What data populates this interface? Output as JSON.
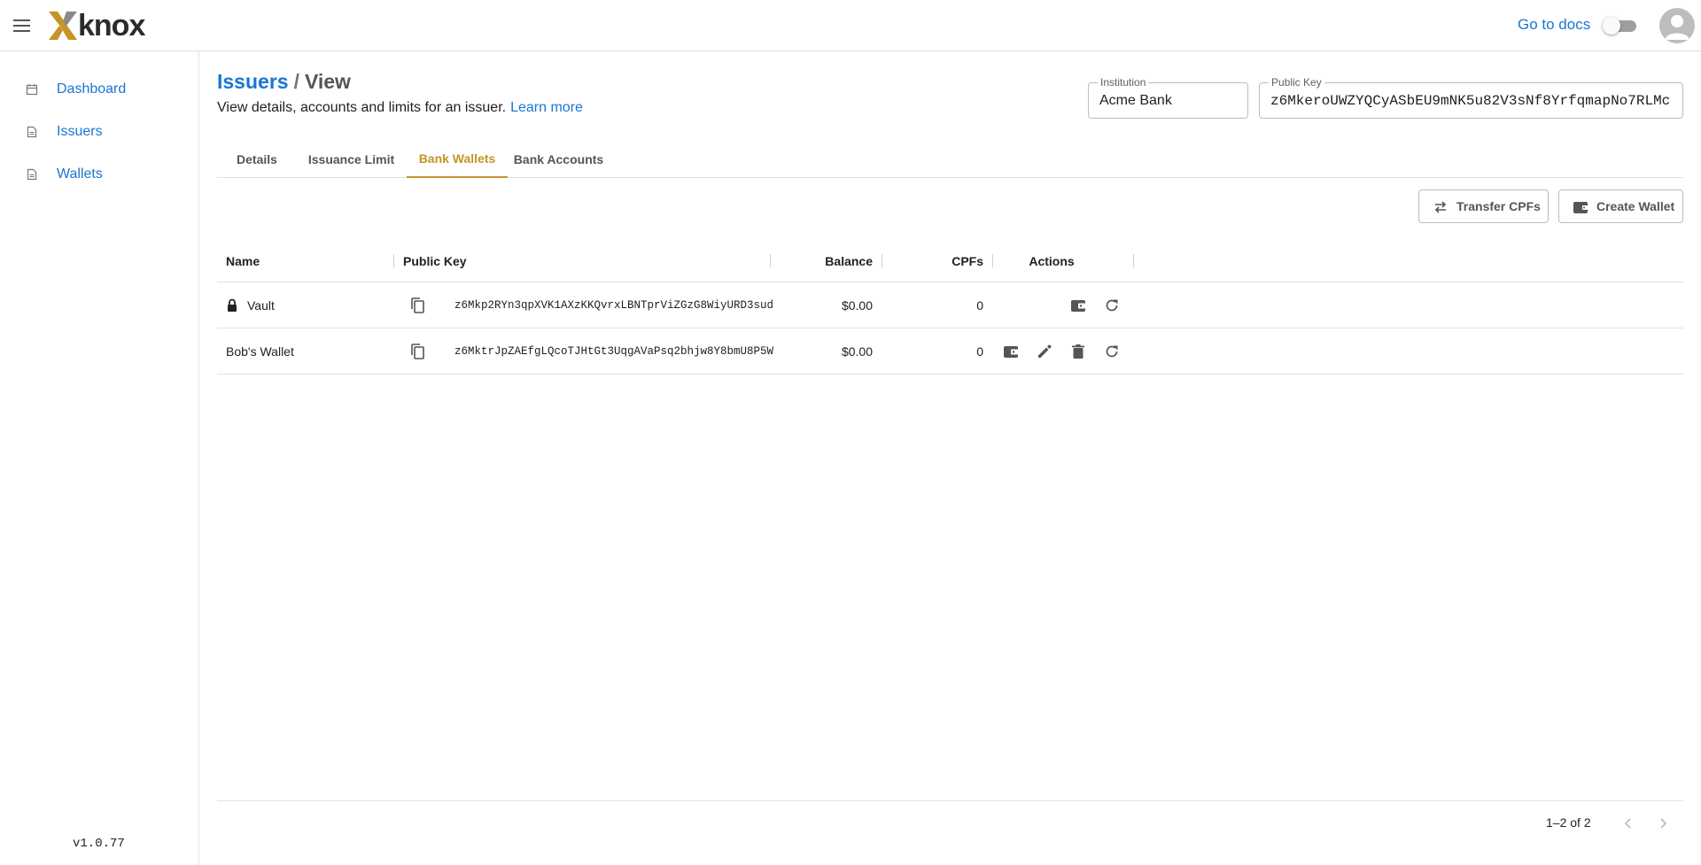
{
  "header": {
    "logo_text": "knox",
    "docs_link": "Go to docs",
    "theme_toggle": "off"
  },
  "sidebar": {
    "items": [
      {
        "label": "Dashboard",
        "icon": "calendar-icon"
      },
      {
        "label": "Issuers",
        "icon": "document-icon"
      },
      {
        "label": "Wallets",
        "icon": "document-icon"
      }
    ],
    "version": "v1.0.77"
  },
  "page": {
    "breadcrumb_parent": "Issuers",
    "breadcrumb_separator": "/",
    "breadcrumb_current": "View",
    "subtitle": "View details, accounts and limits for an issuer.",
    "learn_more": "Learn more"
  },
  "fields": {
    "institution_label": "Institution",
    "institution_value": "Acme Bank",
    "public_key_label": "Public Key",
    "public_key_value": "z6MkeroUWZYQCyASbEU9mNK5u82V3sNf8YrfqmapNo7RLMc"
  },
  "tabs": [
    {
      "label": "Details",
      "active": false
    },
    {
      "label": "Issuance Limit",
      "active": false
    },
    {
      "label": "Bank Wallets",
      "active": true
    },
    {
      "label": "Bank Accounts",
      "active": false
    }
  ],
  "accent_color": "#c69326",
  "link_color": "#1976d2",
  "toolbar": {
    "transfer_label": "Transfer CPFs",
    "create_label": "Create Wallet"
  },
  "table": {
    "columns": [
      "Name",
      "Public Key",
      "Balance",
      "CPFs",
      "Actions"
    ],
    "rows": [
      {
        "name": "Vault",
        "locked": true,
        "public_key": "z6Mkp2RYn3qpXVK1AXzKKQvrxLBNTprViZGzG8WiyURD3sud",
        "balance": "$0.00",
        "cpfs": "0",
        "actions": [
          "wallet-icon",
          "refresh-icon"
        ]
      },
      {
        "name": "Bob's Wallet",
        "locked": false,
        "public_key": "z6MktrJpZAEfgLQcoTJHtGt3UqgAVaPsq2bhjw8Y8bmU8P5W",
        "balance": "$0.00",
        "cpfs": "0",
        "actions": [
          "wallet-icon",
          "edit-icon",
          "delete-icon",
          "refresh-icon"
        ]
      }
    ]
  },
  "pagination": {
    "range": "1–2 of 2"
  }
}
